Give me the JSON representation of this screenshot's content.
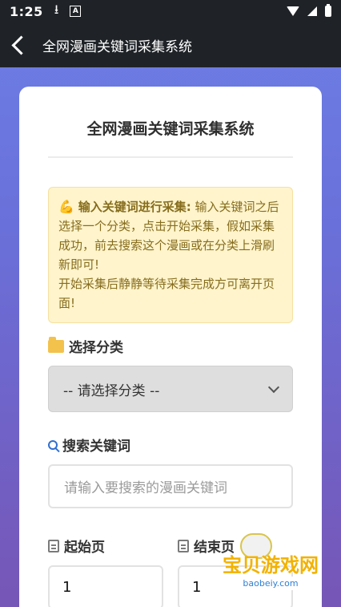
{
  "status_bar": {
    "time": "1:25"
  },
  "app_bar": {
    "title": "全网漫画关键词采集系统"
  },
  "card": {
    "title": "全网漫画关键词采集系统",
    "notice": {
      "emoji": "💪",
      "bold": "输入关键词进行采集:",
      "text": " 输入关键词之后选择一个分类，点击开始采集，假如采集成功，前去搜索这个漫画或在分类上滑刷新即可!",
      "text2": "开始采集后静静等待采集完成方可离开页面!"
    },
    "category": {
      "label": "选择分类",
      "value": "-- 请选择分类 --"
    },
    "keyword": {
      "label": "搜索关键词",
      "placeholder": "请输入要搜索的漫画关键词"
    },
    "start_page": {
      "label": "起始页",
      "value": "1"
    },
    "end_page": {
      "label": "结束页",
      "value": "1"
    }
  },
  "watermark": {
    "text": "宝贝游戏网",
    "url": "baobeiy.com"
  }
}
